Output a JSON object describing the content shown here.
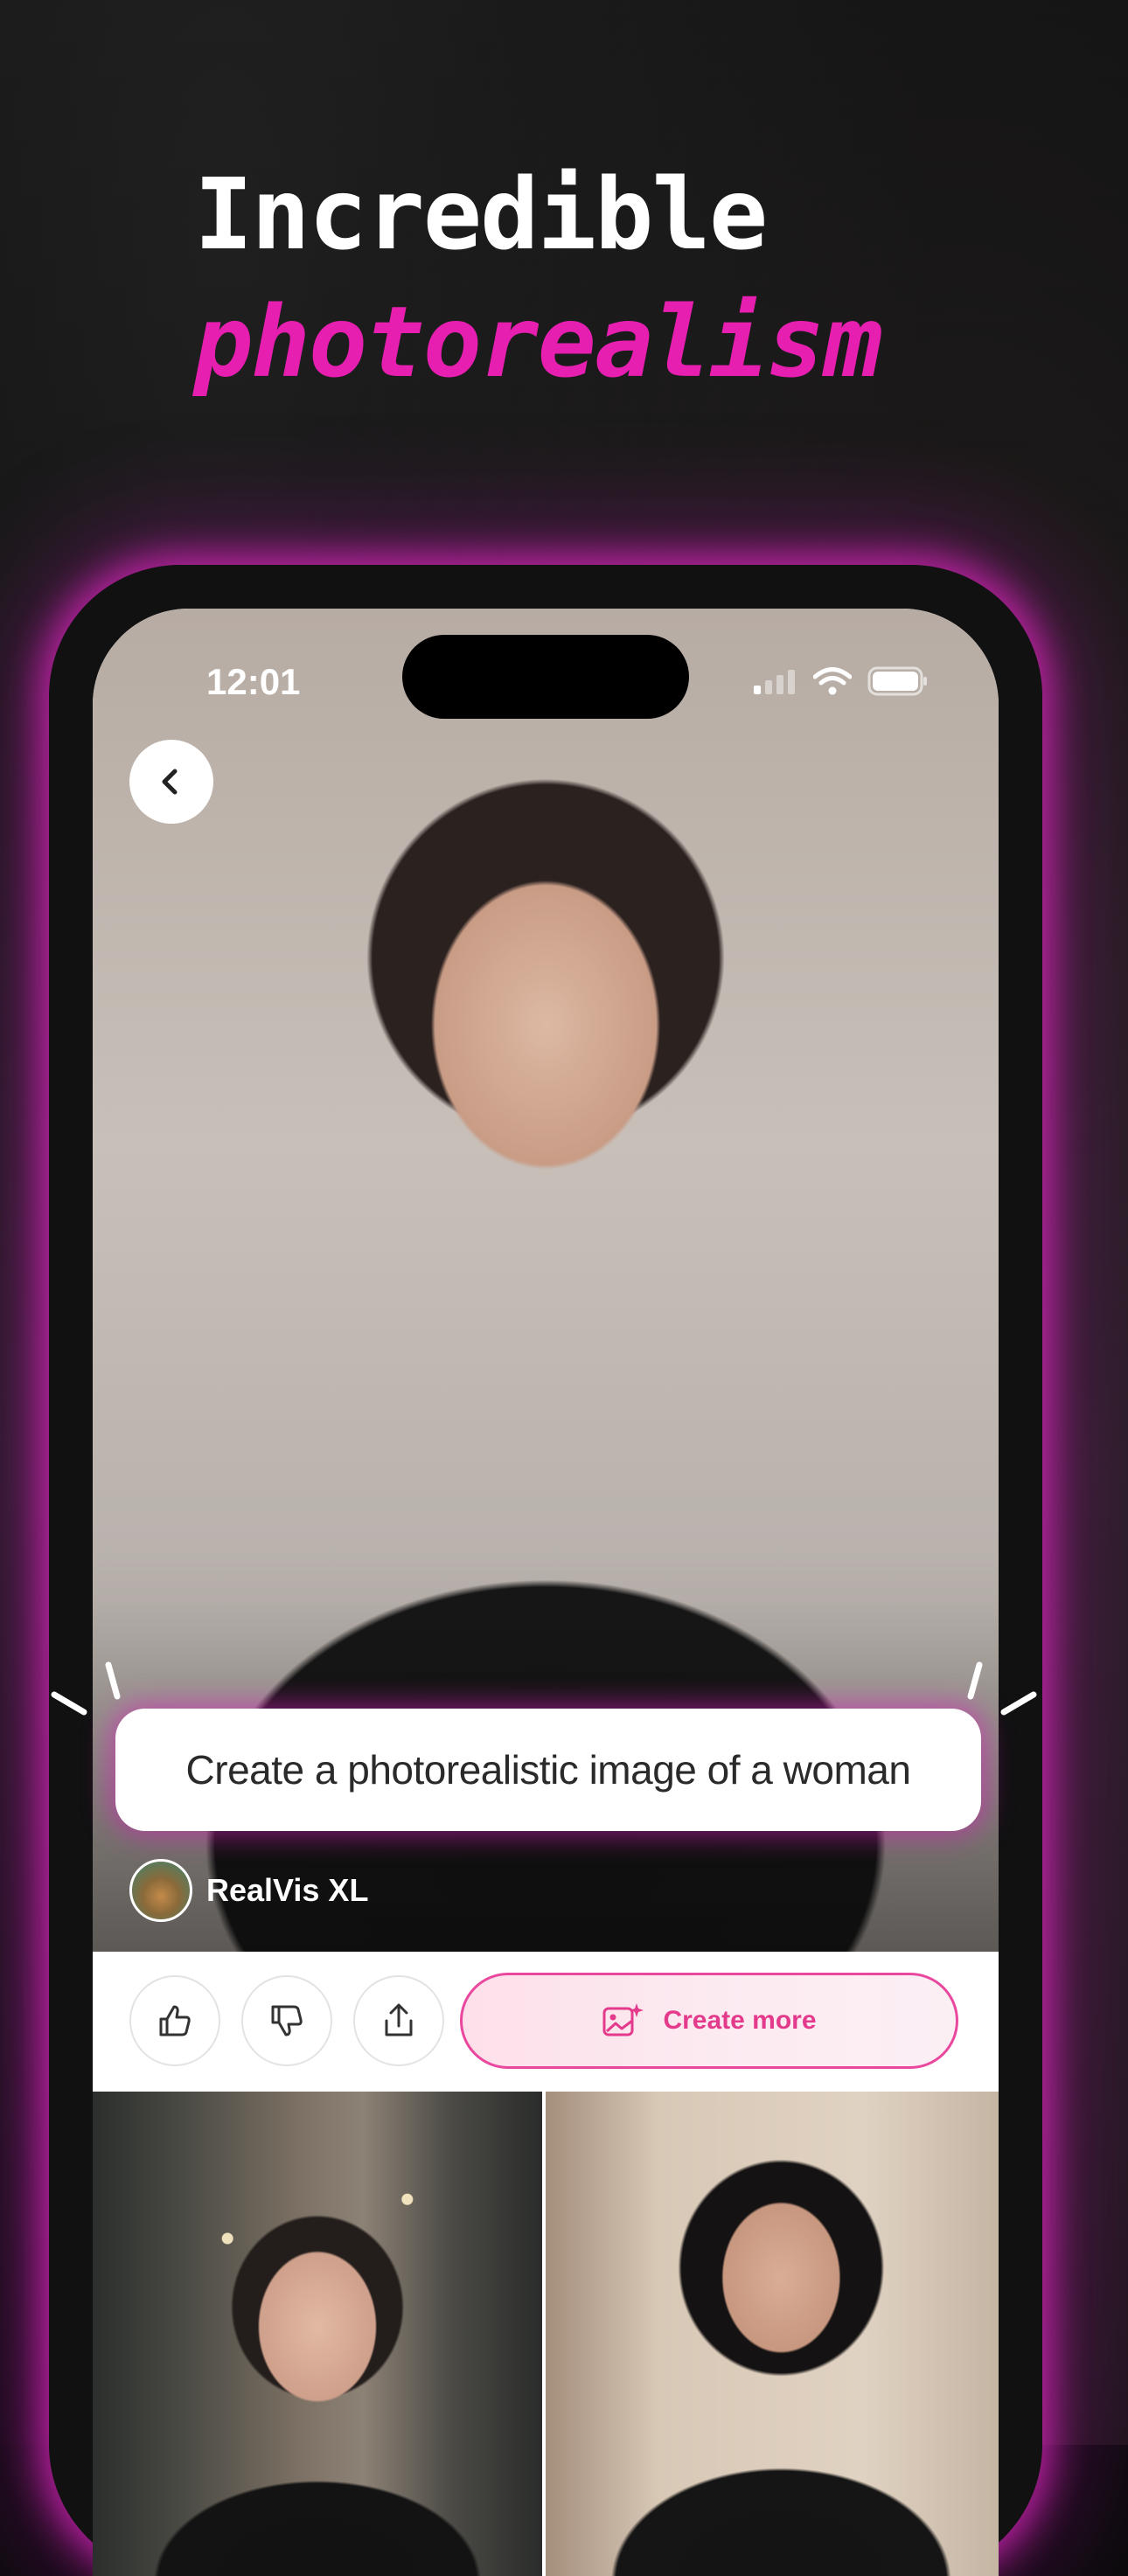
{
  "headline": {
    "line1": "Incredible",
    "line2": "photorealism"
  },
  "colors": {
    "accent": "#e61fb1",
    "button_accent": "#e43a8c",
    "glow": "#e828c8"
  },
  "status_bar": {
    "time": "12:01",
    "icons": [
      "cellular-signal-icon",
      "wifi-icon",
      "battery-icon"
    ]
  },
  "hero": {
    "back_icon": "chevron-left-icon"
  },
  "prompt": {
    "text": "Create a photorealistic image of a woman"
  },
  "model": {
    "name": "RealVis XL"
  },
  "actions": {
    "like_icon": "thumbs-up-icon",
    "dislike_icon": "thumbs-down-icon",
    "share_icon": "share-icon",
    "create_more_label": "Create more",
    "create_more_icon": "image-sparkle-icon"
  }
}
